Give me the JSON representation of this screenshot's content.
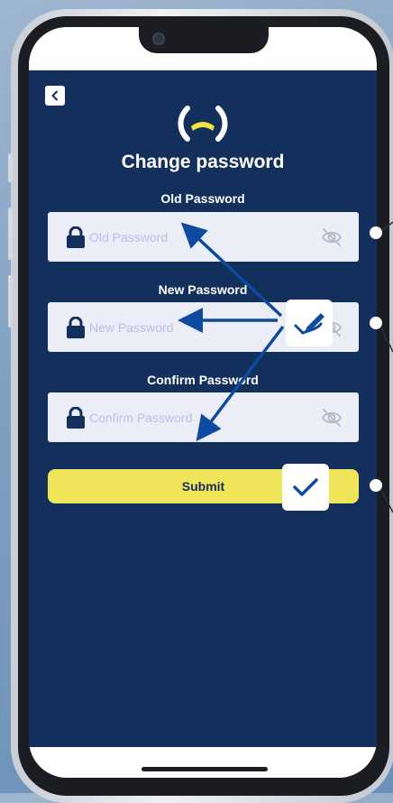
{
  "screen": {
    "title": "Change password"
  },
  "form": {
    "old_password": {
      "label": "Old Password",
      "placeholder": "Old Password",
      "value": ""
    },
    "new_password": {
      "label": "New Password",
      "placeholder": "New Password",
      "value": ""
    },
    "confirm_password": {
      "label": "Confirm Password",
      "placeholder": "Confirm Password",
      "value": ""
    },
    "submit_label": "Submit"
  },
  "icons": {
    "back": "chevron-left-icon",
    "logo": "brand-logo",
    "lock": "lock-icon",
    "visibility": "eye-slash-icon",
    "edit_badge": "pen-check-icon",
    "confirm_badge": "checkmark-icon"
  },
  "colors": {
    "app_background": "#12305b",
    "field_background": "#eceef7",
    "placeholder": "#b8c0e8",
    "submit_button": "#efe55a",
    "accent_yellow": "#f2e243",
    "annotation_arrow": "#0d4aa0"
  }
}
